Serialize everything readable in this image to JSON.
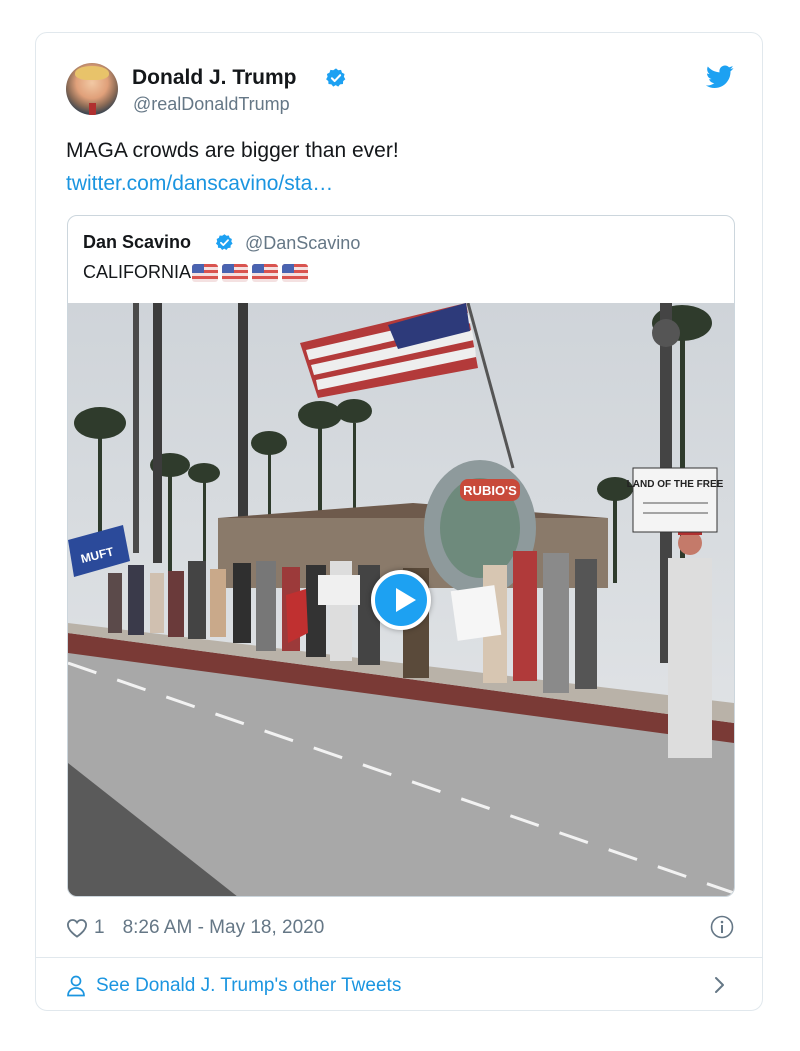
{
  "tweet": {
    "author_name": "Donald J. Trump",
    "author_handle": "@realDonaldTrump",
    "text": "MAGA crowds are bigger than ever!",
    "link_text": "twitter.com/danscavino/sta…",
    "like_count": "1",
    "timestamp": "8:26 AM - May 18, 2020",
    "icons": [
      "verified-badge-icon",
      "twitter-bird-icon",
      "heart-icon",
      "info-icon",
      "person-icon",
      "chevron-right-icon"
    ]
  },
  "quoted_tweet": {
    "author_name": "Dan Scavino",
    "author_handle": "@DanScavino",
    "text": "CALIFORNIA",
    "emoji": [
      "us-flag",
      "us-flag",
      "us-flag",
      "us-flag"
    ],
    "media": {
      "type": "video",
      "sign_left_text": "MUFT",
      "sign_right_text": "LAND OF THE FREE",
      "monument_text": "RUBIO'S"
    }
  },
  "footer": {
    "see_more_label": "See Donald J. Trump's other Tweets"
  },
  "colors": {
    "link": "#1b95e0",
    "verified": "#1da1f2",
    "muted_text": "#657786",
    "border": "#e1e8ed"
  }
}
